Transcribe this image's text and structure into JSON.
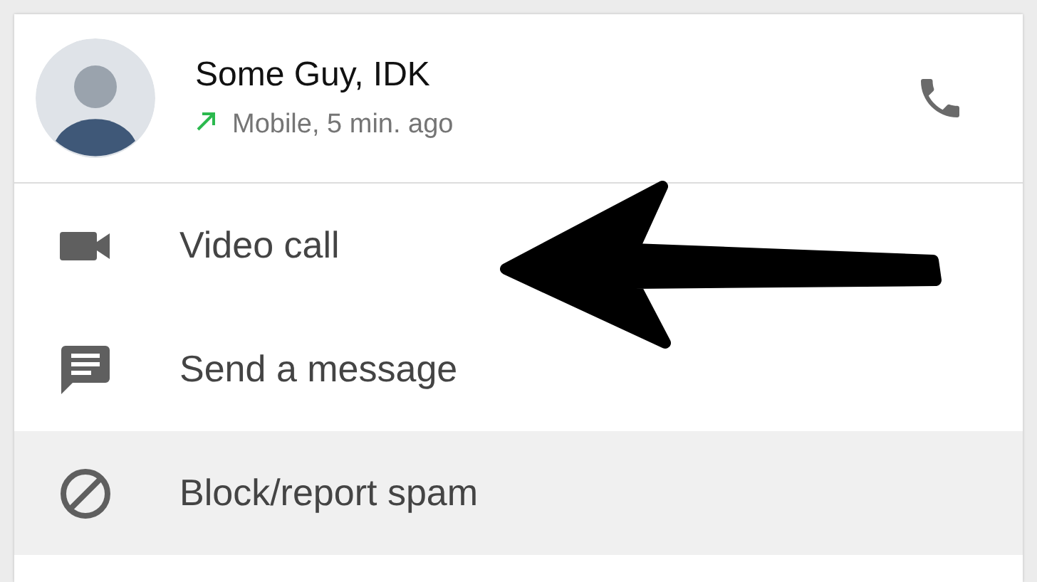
{
  "contact": {
    "name": "Some Guy, IDK",
    "outgoing": true,
    "detail": "Mobile, 5 min. ago"
  },
  "actions": [
    {
      "kind": "video",
      "label": "Video call",
      "selected": false
    },
    {
      "kind": "message",
      "label": "Send a message",
      "selected": false
    },
    {
      "kind": "block",
      "label": "Block/report spam",
      "selected": true
    }
  ]
}
